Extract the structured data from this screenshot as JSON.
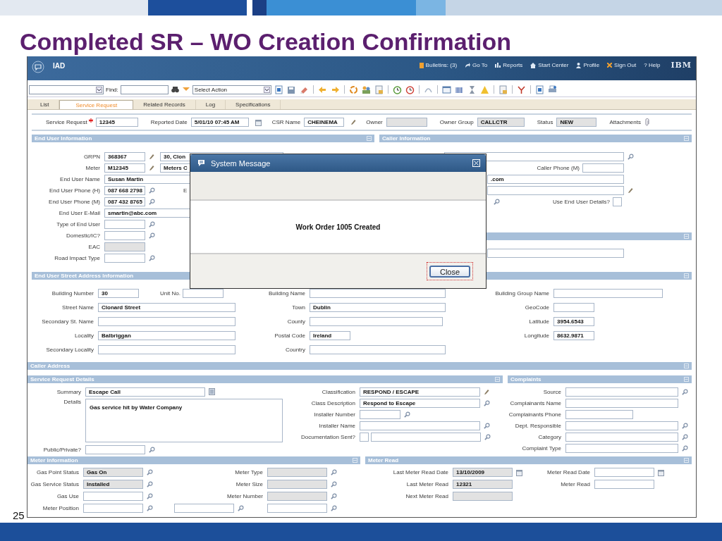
{
  "slide": {
    "title": "Completed SR – WO Creation Confirmation",
    "page_number": "25"
  },
  "app_bar": {
    "title": "IAD",
    "links": [
      "Bulletins: (3)",
      "Go To",
      "Reports",
      "Start Center",
      "Profile",
      "Sign Out",
      "? Help"
    ],
    "brand": "IBM"
  },
  "toolbar": {
    "find_label": "Find:",
    "select_action": "Select Action"
  },
  "tabs": [
    {
      "label": "List",
      "selected": false
    },
    {
      "label": "Service Request",
      "selected": true
    },
    {
      "label": "Related Records",
      "selected": false
    },
    {
      "label": "Log",
      "selected": false
    },
    {
      "label": "Specifications",
      "selected": false
    }
  ],
  "header_fields": [
    {
      "label": "Service Request",
      "required": true,
      "value": "12345"
    },
    {
      "label": "Reported Date",
      "value": "5/01/10 07:45 AM"
    },
    {
      "label": "CSR Name",
      "value": "CHEINEMA"
    },
    {
      "label": "Owner",
      "kind": "readonly"
    },
    {
      "label": "Owner Group",
      "value": "CALLCTR",
      "kind": "readonly"
    },
    {
      "label": "Status",
      "value": "NEW",
      "kind": "readonly"
    },
    {
      "label": "Attachments",
      "kind": "attachment"
    }
  ],
  "end_user_information": {
    "title": "End User Information",
    "columns": [
      [
        {
          "label": "GRPN",
          "value": "368367",
          "extra": {
            "kind": "text",
            "value": "30, Clon"
          }
        },
        {
          "label": "Meter",
          "value": "M12345",
          "extra": {
            "kind": "text",
            "value": "Meters C"
          }
        },
        {
          "label": "End User Name",
          "value": "Susan Martin"
        },
        {
          "label": "End User Phone (H)",
          "value": "087 668 2798",
          "extra": {
            "kind": "label",
            "label": "E"
          }
        },
        {
          "label": "End User Phone (M)",
          "value": "087 432 8765"
        },
        {
          "label": "End User E-Mail",
          "value": "smartin@abc.com"
        },
        {
          "label": "Type of End User"
        },
        {
          "label": "Domestic/IC?"
        },
        {
          "label": "EAC",
          "kind": "readonly"
        },
        {
          "label": "Road Impact Type"
        }
      ]
    ]
  },
  "caller_information": {
    "title": "Caller Information",
    "fields": [
      {
        "kind": "text"
      },
      {
        "label": "Caller Phone (M)",
        "kind": "text"
      },
      {
        "kind": "text",
        "value": ".com"
      },
      {
        "kind": "text"
      },
      {
        "label": "Use End User Details?",
        "kind": "check",
        "checked": false
      }
    ]
  },
  "covered_section": {
    "fields": [
      {
        "kind": "text"
      }
    ]
  },
  "street_address": {
    "title": "End User Street Address Information",
    "columns": [
      [
        {
          "label": "Building Number",
          "value": "30",
          "extra": {
            "kind": "text",
            "label": "Unit No."
          }
        },
        {
          "label": "Street Name",
          "value": "Clonard Street"
        },
        {
          "label": "Secondary St. Name"
        },
        {
          "label": "Locality",
          "value": "Balbriggan"
        },
        {
          "label": "Secondary Locality"
        }
      ],
      [
        {
          "label": "Building Name"
        },
        {
          "label": "Town",
          "value": "Dublin"
        },
        {
          "label": "County"
        },
        {
          "label": "Postal Code",
          "value": "Ireland"
        },
        {
          "label": "Country"
        }
      ],
      [
        {
          "label": "Building Group Name"
        },
        {
          "label": "GeoCode"
        },
        {
          "label": "Latitude",
          "value": "3954.6543"
        },
        {
          "label": "Longitude",
          "value": "8632.9871"
        }
      ]
    ]
  },
  "caller_address": {
    "title": "Caller Address"
  },
  "service_request_details": {
    "title": "Service Request Details",
    "columns": [
      [
        {
          "label": "Summary",
          "value": "Escape Call"
        },
        {
          "label": "Details",
          "value": "Gas service hit by Water Company",
          "kind": "area"
        },
        {
          "label": "Public/Private?"
        }
      ],
      [
        {
          "label": "Classification",
          "value": "RESPOND / ESCAPE"
        },
        {
          "label": "Class Description",
          "value": "Respond to Escape"
        },
        {
          "label": "Installer Number"
        },
        {
          "label": "Installer Name"
        },
        {
          "label": "Documentation Sent?",
          "kind": "check_text",
          "checked": false
        }
      ]
    ]
  },
  "complaints": {
    "title": "Complaints",
    "columns": [
      [
        {
          "label": "Source"
        },
        {
          "label": "Complainants Name"
        },
        {
          "label": "Complainants Phone"
        },
        {
          "label": "Dept. Responsible"
        },
        {
          "label": "Category"
        },
        {
          "label": "Complaint Type"
        }
      ]
    ]
  },
  "meter_information": {
    "title": "Meter Information",
    "columns": [
      [
        {
          "label": "Gas Point Status",
          "value": "Gas On",
          "kind": "readonly"
        },
        {
          "label": "Gas Service Status",
          "value": "Installed",
          "kind": "readonly"
        },
        {
          "label": "Gas Use"
        },
        {
          "label": "Meter Position",
          "extra": {
            "kind": "text"
          }
        }
      ],
      [
        {
          "label": "Meter Type",
          "kind": "readonly"
        },
        {
          "label": "Meter Size",
          "kind": "readonly"
        },
        {
          "label": "Meter Number",
          "kind": "readonly"
        },
        {
          "kind": "text"
        }
      ]
    ]
  },
  "meter_read": {
    "title": "Meter Read",
    "columns": [
      [
        {
          "label": "Last Meter Read Date",
          "value": "13/10/2009",
          "kind": "readonly"
        },
        {
          "label": "Last Meter Read",
          "value": "12321",
          "kind": "readonly"
        },
        {
          "label": "Next Meter Read",
          "kind": "readonly"
        }
      ],
      [
        {
          "label": "Meter Read Date"
        },
        {
          "label": "Meter Read"
        }
      ]
    ]
  },
  "dialog": {
    "title": "System Message",
    "message": "Work Order 1005 Created",
    "button": "Close"
  }
}
